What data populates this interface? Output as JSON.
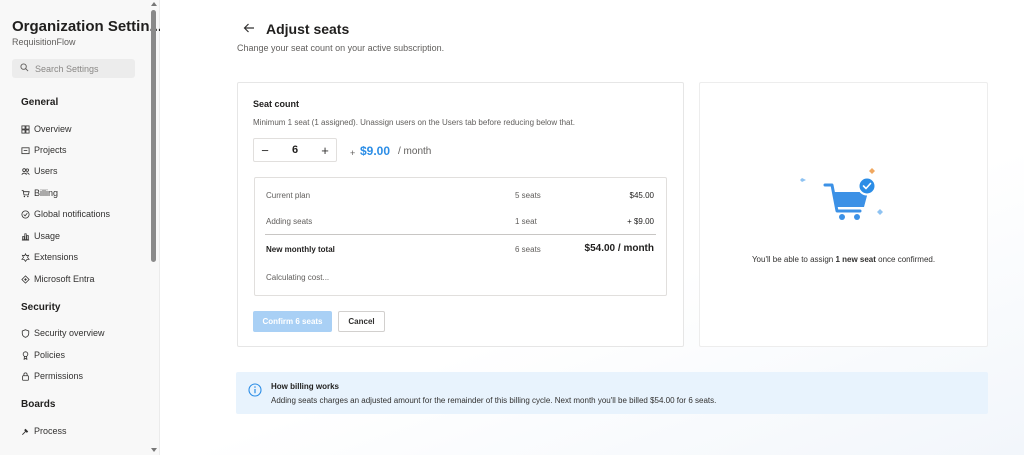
{
  "sidebar": {
    "org_title": "Organization Settin...",
    "org_subtitle": "RequisitionFlow",
    "search_placeholder": "Search Settings",
    "sections": {
      "general": "General",
      "security": "Security",
      "boards": "Boards"
    },
    "general_items": [
      {
        "label": "Overview",
        "icon": "grid-icon"
      },
      {
        "label": "Projects",
        "icon": "projects-icon"
      },
      {
        "label": "Users",
        "icon": "users-icon"
      },
      {
        "label": "Billing",
        "icon": "cart-icon"
      },
      {
        "label": "Global notifications",
        "icon": "notification-icon"
      },
      {
        "label": "Usage",
        "icon": "usage-icon"
      },
      {
        "label": "Extensions",
        "icon": "extensions-icon"
      },
      {
        "label": "Microsoft Entra",
        "icon": "entra-icon"
      }
    ],
    "security_items": [
      {
        "label": "Security overview",
        "icon": "shield-icon"
      },
      {
        "label": "Policies",
        "icon": "policy-icon"
      },
      {
        "label": "Permissions",
        "icon": "lock-icon"
      }
    ],
    "boards_items": [
      {
        "label": "Process",
        "icon": "process-icon"
      }
    ]
  },
  "header": {
    "title": "Adjust seats",
    "subtitle": "Change your seat count on your active subscription."
  },
  "seat_card": {
    "title": "Seat count",
    "help": "Minimum 1 seat (1 assigned). Unassign users on the Users tab before reducing below that.",
    "stepper_minus": "−",
    "stepper_value": "6",
    "stepper_plus": "+",
    "price_prefix": "+",
    "price_value": "$9.00",
    "price_period": "/ month"
  },
  "summary": {
    "rows": [
      {
        "label": "Current plan",
        "qty": "5 seats",
        "amount": "$45.00"
      },
      {
        "label": "Adding seats",
        "qty": "1 seat",
        "amount": "+ $9.00"
      }
    ],
    "total_label": "New monthly total",
    "total_qty": "6 seats",
    "total_amount": "$54.00 / month",
    "status": "Calculating cost..."
  },
  "actions": {
    "confirm": "Confirm 6 seats",
    "cancel": "Cancel"
  },
  "confirm_panel": {
    "text_before": "You'll be able to assign ",
    "text_bold": "1 new seat",
    "text_after": " once confirmed."
  },
  "info": {
    "title": "How billing works",
    "text": "Adding seats charges an adjusted amount for the remainder of this billing cycle. Next month you'll be billed $54.00 for 6 seats."
  },
  "colors": {
    "accent": "#2b8de6",
    "confirm_disabled": "#a9d0f5",
    "info_bg": "#e8f3fd"
  }
}
